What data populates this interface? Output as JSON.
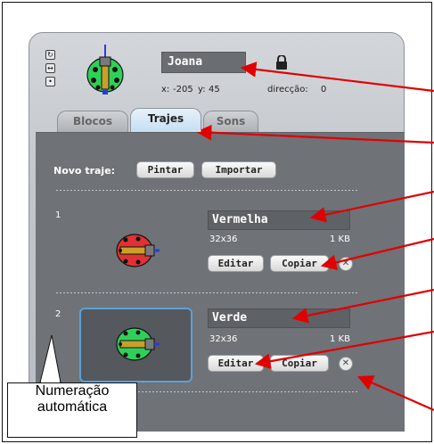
{
  "sprite": {
    "name": "Joana",
    "x_label": "x:",
    "x_value": "-205",
    "y_label": "y:",
    "y_value": "45",
    "direction_label": "direcção:",
    "direction_value": "0"
  },
  "rotation_tools": [
    "↻",
    "↔",
    "•"
  ],
  "tabs": [
    {
      "label": "Blocos"
    },
    {
      "label": "Trajes"
    },
    {
      "label": "Sons"
    }
  ],
  "new_costume": {
    "label": "Novo traje:",
    "paint_label": "Pintar",
    "import_label": "Importar"
  },
  "costumes": [
    {
      "index": "1",
      "name": "Vermelha",
      "size": "32x36",
      "bytes": "1 KB",
      "edit_label": "Editar",
      "copy_label": "Copiar",
      "delete_label": "✕",
      "color": "#e03232"
    },
    {
      "index": "2",
      "name": "Verde",
      "size": "32x36",
      "bytes": "1 KB",
      "edit_label": "Editar",
      "copy_label": "Copiar",
      "delete_label": "✕",
      "color": "#2fd05a"
    }
  ],
  "callout": {
    "line1": "Numeração",
    "line2": "automática"
  },
  "colors": {
    "arrow": "#e00000",
    "selected_border": "#5aa2dc"
  }
}
